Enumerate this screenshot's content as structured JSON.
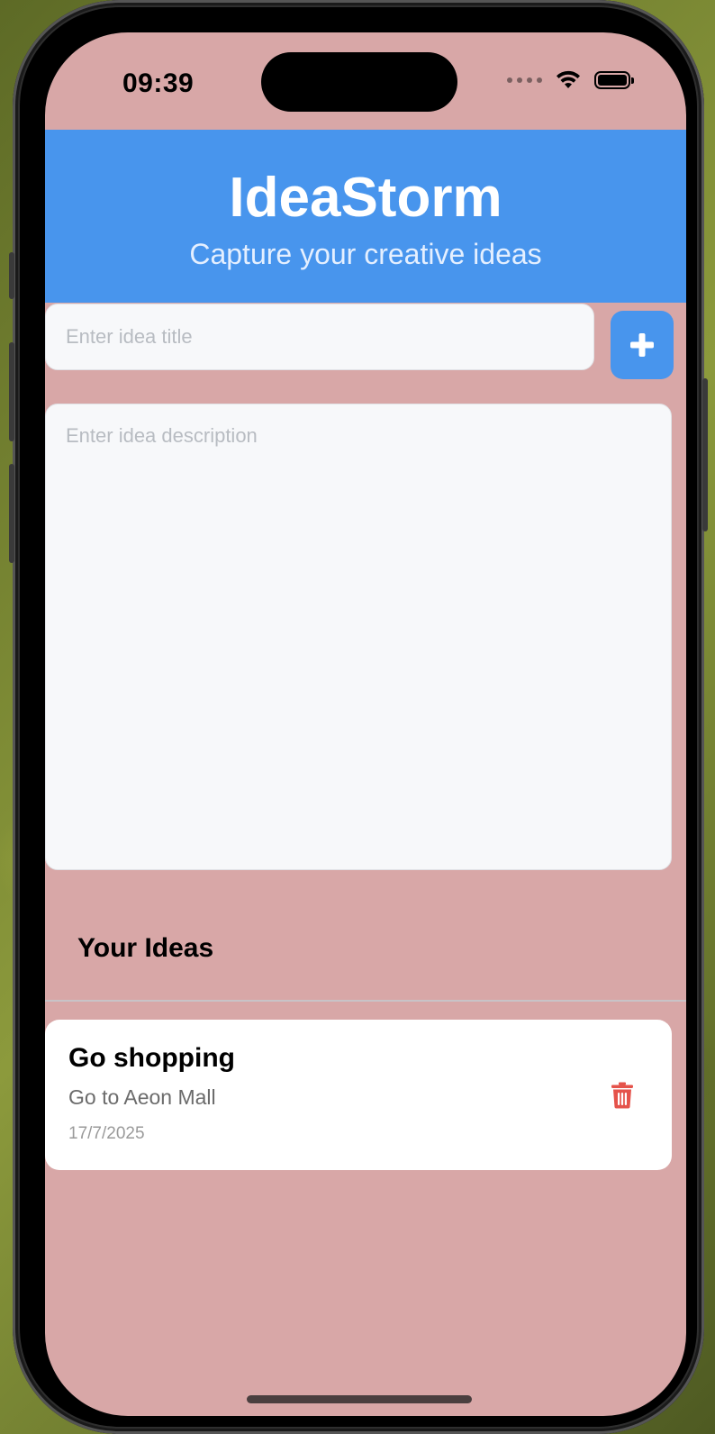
{
  "status_bar": {
    "time": "09:39",
    "icons": [
      "signal-dots-icon",
      "wifi-icon",
      "battery-icon"
    ]
  },
  "header": {
    "title": "IdeaStorm",
    "subtitle": "Capture your creative ideas",
    "background_color": "#4895ed"
  },
  "form": {
    "title_placeholder": "Enter idea title",
    "title_value": "",
    "description_placeholder": "Enter idea description",
    "description_value": "",
    "add_button_icon": "plus-icon"
  },
  "ideas_section": {
    "title": "Your Ideas",
    "items": [
      {
        "title": "Go shopping",
        "description": "Go to Aeon Mall",
        "date": "17/7/2025",
        "action_icon": "trash-icon",
        "action_color": "#e5534b"
      }
    ]
  },
  "colors": {
    "screen_background": "#d8a7a7",
    "accent": "#4895ed",
    "card_background": "#ffffff"
  }
}
